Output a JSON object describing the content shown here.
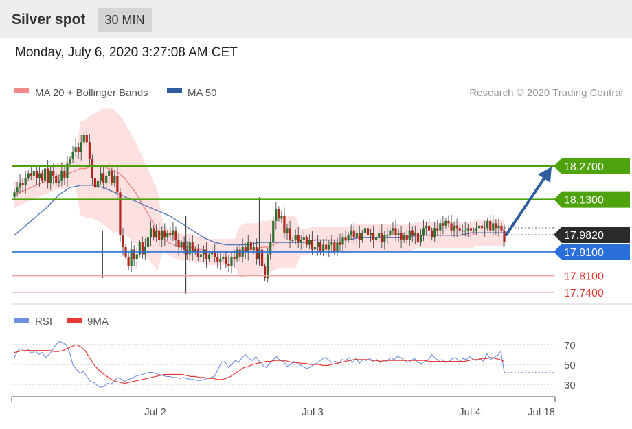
{
  "header": {
    "title": "Silver spot",
    "timeframe": "30 MIN",
    "datetime": "Monday, July 6, 2020 3:27:08 AM CET",
    "credit": "Research © 2020 Trading Central"
  },
  "legend": {
    "ma20": "MA 20 + Bollinger Bands",
    "ma50": "MA 50",
    "rsi": "RSI",
    "rsi_ma": "9MA"
  },
  "colors": {
    "green": "#4ea30c",
    "blue": "#2a6fdb",
    "red": "#e53935",
    "dark": "#2b2b2b",
    "arrow": "#2e5e9e",
    "candle_up": "#2f6f2f",
    "candle_down": "#b3261e",
    "band": "#fcd9d9"
  },
  "levels": [
    {
      "value": 18.27,
      "label": "18.2700",
      "kind": "resistance"
    },
    {
      "value": 18.13,
      "label": "18.1300",
      "kind": "resistance"
    },
    {
      "value": 17.982,
      "label": "17.9820",
      "kind": "current"
    },
    {
      "value": 17.91,
      "label": "17.9100",
      "kind": "pivot"
    },
    {
      "value": 17.81,
      "label": "17.8100",
      "kind": "support"
    },
    {
      "value": 17.74,
      "label": "17.7400",
      "kind": "support"
    }
  ],
  "rsi_ticks": [
    {
      "value": 70,
      "label": "70"
    },
    {
      "value": 50,
      "label": "50"
    },
    {
      "value": 30,
      "label": "30"
    }
  ],
  "x_labels": [
    "Jul 2",
    "Jul 3",
    "Jul 4",
    "Jul 18"
  ],
  "chart_data": [
    {
      "type": "candlestick",
      "title": "Silver spot",
      "interval": "30 MIN",
      "ylim": [
        17.69,
        18.44
      ],
      "close": [
        18.16,
        18.18,
        18.2,
        18.19,
        18.22,
        18.24,
        18.23,
        18.25,
        18.22,
        18.24,
        18.21,
        18.26,
        18.2,
        18.25,
        18.23,
        18.2,
        18.21,
        18.25,
        18.22,
        18.28,
        18.3,
        18.33,
        18.35,
        18.33,
        18.37,
        18.4,
        18.37,
        18.3,
        18.22,
        18.18,
        18.21,
        18.24,
        18.2,
        18.23,
        18.25,
        18.2,
        18.23,
        18.16,
        17.98,
        17.93,
        17.89,
        17.85,
        17.92,
        17.88,
        17.9,
        17.95,
        17.9,
        17.93,
        17.97,
        18.01,
        17.97,
        18.0,
        17.96,
        18.0,
        17.97,
        17.99,
        17.98,
        18.0,
        17.96,
        17.93,
        17.95,
        17.92,
        17.9,
        17.95,
        17.91,
        17.92,
        17.89,
        17.9,
        17.92,
        17.88,
        17.9,
        17.91,
        17.89,
        17.87,
        17.88,
        17.89,
        17.86,
        17.85,
        17.89,
        17.88,
        17.92,
        17.89,
        17.93,
        17.91,
        17.95,
        17.92,
        17.93,
        17.88,
        17.92,
        17.85,
        17.8,
        17.9,
        17.95,
        18.04,
        18.09,
        18.05,
        18.06,
        17.99,
        18.01,
        17.96,
        17.96,
        17.98,
        17.95,
        17.96,
        17.97,
        17.94,
        17.96,
        17.92,
        17.93,
        17.95,
        17.91,
        17.94,
        17.92,
        17.94,
        17.95,
        17.91,
        17.95,
        17.94,
        17.97,
        17.96,
        17.98,
        18.0,
        17.97,
        17.99,
        17.96,
        17.99,
        18.01,
        17.98,
        17.99,
        17.96,
        17.97,
        17.99,
        17.95,
        17.98,
        17.98,
        18.0,
        18.01,
        17.98,
        17.99,
        17.96,
        17.98,
        17.96,
        18.0,
        17.98,
        17.99,
        17.95,
        17.98,
        18.01,
        18.02,
        18.0,
        17.97,
        18.01,
        18.0,
        18.03,
        18.02,
        18.04,
        18.03,
        18.0,
        18.02,
        18.01,
        18.0,
        18.0,
        18.0,
        18.01,
        18.0,
        18.0,
        18.01,
        18.02,
        18.01,
        18.01,
        18.04,
        18.0,
        18.03,
        18.01,
        18.02,
        18.0,
        17.95
      ],
      "series": [
        {
          "name": "MA 20",
          "values": [
            18.15,
            18.16,
            18.17,
            18.18,
            18.19,
            18.2,
            18.21,
            18.22,
            18.23,
            18.23,
            18.24,
            18.25,
            18.26,
            18.26,
            18.27,
            18.27,
            18.27,
            18.26,
            18.25,
            18.24,
            18.22,
            18.19,
            18.16,
            18.12,
            18.08,
            18.04,
            18.0,
            17.97,
            17.95,
            17.94,
            17.93,
            17.93,
            17.93,
            17.92,
            17.92,
            17.91,
            17.91,
            17.91,
            17.91,
            17.91,
            17.91,
            17.91,
            17.92,
            17.92,
            17.92,
            17.93,
            17.93,
            17.94,
            17.95,
            17.95,
            17.95,
            17.95,
            17.95,
            17.95,
            17.96,
            17.96,
            17.96,
            17.96,
            17.96,
            17.96,
            17.96,
            17.96,
            17.97,
            17.97,
            17.97,
            17.97,
            17.97,
            17.97,
            17.97,
            17.97,
            17.97,
            17.97,
            17.97,
            17.98,
            17.98,
            17.98,
            17.98,
            17.98,
            17.98,
            17.98,
            17.98,
            17.98,
            17.98,
            17.98,
            17.99,
            17.99,
            17.99,
            17.99,
            17.99,
            17.99
          ]
        },
        {
          "name": "MA 50",
          "values": [
            17.98,
            18.02,
            18.06,
            18.1,
            18.15,
            18.18,
            18.19,
            18.19,
            18.18,
            18.16,
            18.14,
            18.12,
            18.1,
            18.08,
            18.06,
            18.03,
            18.0,
            17.97,
            17.95,
            17.94,
            17.94,
            17.94,
            17.95,
            17.95,
            17.95,
            17.95,
            17.95,
            17.96,
            17.96,
            17.96,
            17.96,
            17.97,
            17.97,
            17.97,
            17.97,
            17.97,
            17.98,
            17.98,
            17.98,
            17.98,
            17.98,
            17.99,
            17.99,
            17.99,
            17.99
          ]
        }
      ],
      "annotations": [
        "arrow up toward 18.2700"
      ]
    },
    {
      "type": "line",
      "series": [
        {
          "name": "RSI",
          "values": [
            57,
            64,
            66,
            63,
            65,
            61,
            64,
            60,
            62,
            57,
            60,
            64,
            70,
            73,
            72,
            70,
            62,
            49,
            45,
            41,
            43,
            38,
            33,
            32,
            29,
            27,
            28,
            31,
            30,
            34,
            37,
            35,
            33,
            35,
            36,
            38,
            39,
            40,
            41,
            42,
            42,
            41,
            40,
            39,
            38,
            38,
            37,
            37,
            36,
            37,
            36,
            35,
            35,
            34,
            34,
            35,
            36,
            37,
            38,
            45,
            52,
            53,
            47,
            50,
            54,
            52,
            57,
            60,
            56,
            54,
            58,
            53,
            49,
            47,
            51,
            55,
            58,
            54,
            53,
            48,
            50,
            53,
            51,
            49,
            47,
            46,
            48,
            50,
            52,
            55,
            57,
            55,
            52,
            53,
            51,
            55,
            54,
            57,
            52,
            56,
            51,
            55,
            54,
            56,
            53,
            55,
            52,
            54,
            53,
            57,
            55,
            58,
            57,
            54,
            52,
            54,
            56,
            52,
            51,
            53,
            55,
            60,
            56,
            54,
            55,
            52,
            53,
            56,
            57,
            52,
            56,
            55,
            58,
            55,
            54,
            56,
            53,
            61,
            55,
            57,
            59,
            63,
            42
          ]
        },
        {
          "name": "9MA",
          "values": [
            62,
            63,
            64,
            64,
            64,
            64,
            64,
            64,
            64,
            63,
            63,
            64,
            66,
            68,
            70,
            68,
            64,
            57,
            50,
            45,
            41,
            38,
            35,
            33,
            32,
            31,
            32,
            33,
            34,
            35,
            36,
            37,
            38,
            39,
            40,
            40,
            40,
            40,
            40,
            39,
            38,
            38,
            37,
            37,
            36,
            36,
            35,
            35,
            36,
            38,
            41,
            44,
            47,
            48,
            50,
            51,
            52,
            53,
            53,
            54,
            54,
            54,
            53,
            52,
            52,
            51,
            51,
            50,
            50,
            50,
            49,
            49,
            50,
            51,
            52,
            53,
            54,
            55,
            55,
            55,
            55,
            54,
            54,
            53,
            54,
            54,
            54,
            54,
            54,
            54,
            54,
            54,
            54,
            54,
            53,
            53,
            53,
            53,
            53,
            53,
            53,
            53,
            53,
            54,
            55,
            55,
            56,
            56,
            57,
            56,
            55,
            53
          ]
        }
      ],
      "yticks": [
        70,
        50,
        30
      ],
      "ylim": [
        22,
        78
      ],
      "xlabels": [
        "Jul 2",
        "Jul 3",
        "Jul 4",
        "Jul 18"
      ]
    }
  ]
}
